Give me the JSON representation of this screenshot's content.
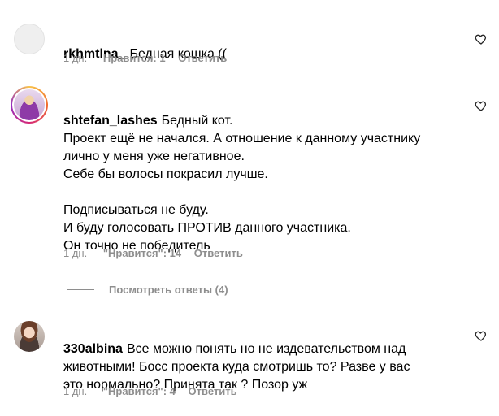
{
  "comments": [
    {
      "username": "rkhmtlna_",
      "text": "Бедная кошка ((",
      "time": "1 дн.",
      "likes": "Нравится: 1",
      "reply": "Ответить"
    },
    {
      "username": "shtefan_lashes",
      "text": "Бедный кот.\nПроект ещё не начался. А отношение к данному участнику\nлично у меня уже негативное.\nСебе бы волосы покрасил лучше.\n\nПодписываться не буду.\nИ буду голосовать ПРОТИВ данного участника.\nОн точно не победитель",
      "time": "1 дн.",
      "likes": "\"Нравится\": 14",
      "reply": "Ответить"
    },
    {
      "username": "330albina",
      "text": "Все можно понять но не издевательством над\nживотными! Босс проекта куда смотришь то? Разве у вас\nэто нормально? Принята так ? Позор уж",
      "time": "1 дн.",
      "likes": "\"Нравится\": 4",
      "reply": "Ответить"
    }
  ],
  "view_replies": "Посмотреть ответы (4)",
  "icons": {
    "like": "heart-outline-icon"
  }
}
